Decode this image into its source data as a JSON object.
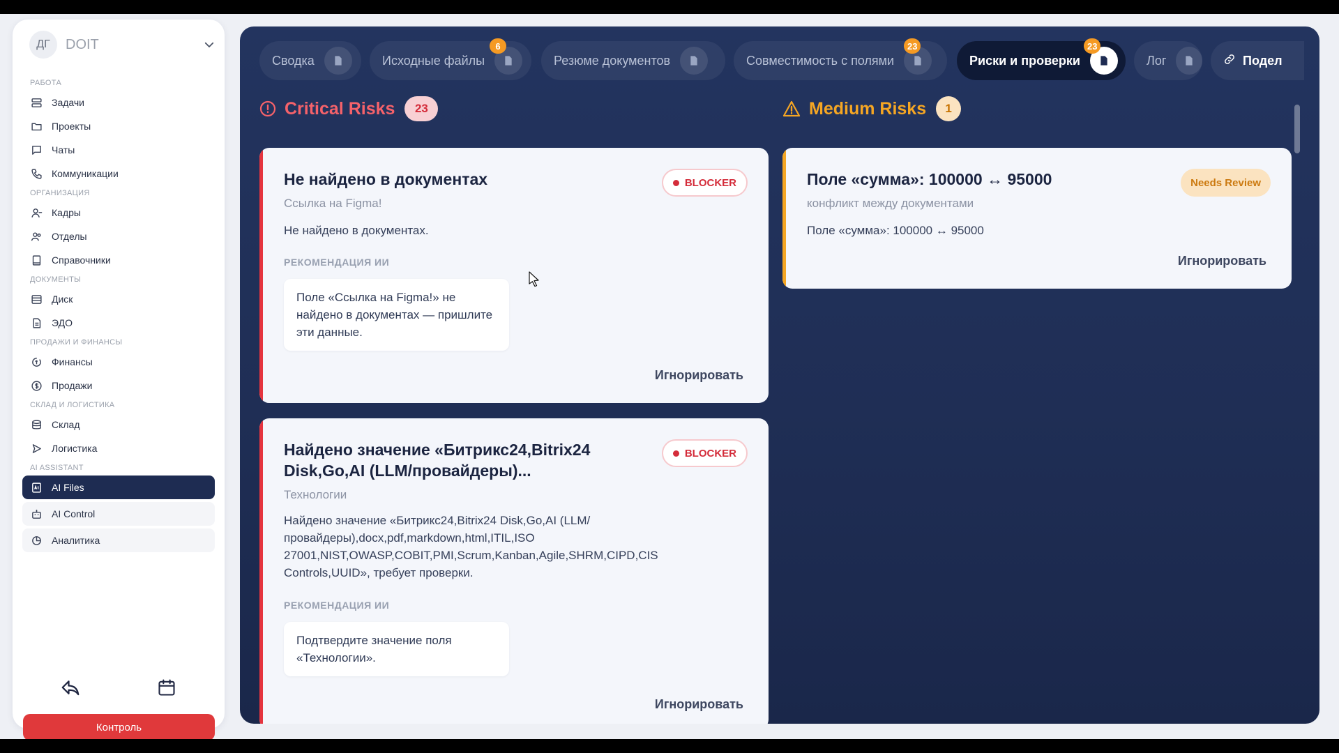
{
  "sidebar": {
    "workspace": {
      "avatar": "ДГ",
      "name": "DOIT"
    },
    "sections": [
      {
        "title": "РАБОТА",
        "items": [
          {
            "label": "Задачи",
            "icon": "tasks-icon"
          },
          {
            "label": "Проекты",
            "icon": "folder-icon"
          },
          {
            "label": "Чаты",
            "icon": "chat-icon"
          },
          {
            "label": "Коммуникации",
            "icon": "phone-icon"
          }
        ]
      },
      {
        "title": "ОРГАНИЗАЦИЯ",
        "items": [
          {
            "label": "Кадры",
            "icon": "user-icon"
          },
          {
            "label": "Отделы",
            "icon": "users-icon"
          },
          {
            "label": "Справочники",
            "icon": "book-icon"
          }
        ]
      },
      {
        "title": "ДОКУМЕНТЫ",
        "items": [
          {
            "label": "Диск",
            "icon": "disk-icon"
          },
          {
            "label": "ЭДО",
            "icon": "document-icon"
          }
        ]
      },
      {
        "title": "ПРОДАЖИ И ФИНАНСЫ",
        "items": [
          {
            "label": "Финансы",
            "icon": "finance-icon"
          },
          {
            "label": "Продажи",
            "icon": "dollar-icon"
          }
        ]
      },
      {
        "title": "СКЛАД И ЛОГИСТИКА",
        "items": [
          {
            "label": "Склад",
            "icon": "warehouse-icon"
          },
          {
            "label": "Логистика",
            "icon": "send-icon"
          }
        ]
      },
      {
        "title": "AI ASSISTANT",
        "items": [
          {
            "label": "AI Files",
            "icon": "ai-file-icon",
            "active": true
          },
          {
            "label": "AI Control",
            "icon": "robot-icon"
          },
          {
            "label": "Аналитика",
            "icon": "analytics-icon"
          }
        ]
      }
    ],
    "control_button": "Контроль"
  },
  "tabs": [
    {
      "label": "Сводка"
    },
    {
      "label": "Исходные файлы",
      "badge": "6"
    },
    {
      "label": "Резюме документов"
    },
    {
      "label": "Совместимость с полями",
      "badge": "23"
    },
    {
      "label": "Риски и проверки",
      "badge": "23",
      "active": true
    },
    {
      "label": "Лог"
    },
    {
      "label": "Подел",
      "icon": "link-icon"
    }
  ],
  "critical": {
    "title": "Critical Risks",
    "count": "23",
    "cards": [
      {
        "title": "Не найдено в документах",
        "subtitle": "Ссылка на Figma!",
        "badge": "BLOCKER",
        "body": "Не найдено в документах.",
        "rec_heading": "РЕКОМЕНДАЦИЯ ИИ",
        "rec_text": "Поле «Ссылка на Figma!» не найдено в документах — пришлите эти данные.",
        "ignore": "Игнорировать"
      },
      {
        "title": "Найдено значение «Битрикс24,Bitrix24 Disk,Go,AI (LLM/провайдеры)...",
        "subtitle": "Технологии",
        "badge": "BLOCKER",
        "body": "Найдено значение «Битрикс24,Bitrix24 Disk,Go,AI (LLM/провайдеры),docx,pdf,markdown,html,ITIL,ISO 27001,NIST,OWASP,COBIT,PMI,Scrum,Kanban,Agile,SHRM,CIPD,CIS Controls,UUID», требует проверки.",
        "rec_heading": "РЕКОМЕНДАЦИЯ ИИ",
        "rec_text": "Подтвердите значение поля «Технологии».",
        "ignore": "Игнорировать"
      }
    ]
  },
  "medium": {
    "title": "Medium Risks",
    "count": "1",
    "cards": [
      {
        "title": "Поле «сумма»: 100000 ↔ 95000",
        "subtitle": "конфликт между документами",
        "badge": "Needs Review",
        "body": "Поле «сумма»: 100000 ↔ 95000",
        "ignore": "Игнорировать"
      }
    ]
  },
  "colors": {
    "accent_dark": "#1e2c52",
    "critical": "#e5343e",
    "medium": "#f5a623",
    "control": "#e0393b"
  }
}
